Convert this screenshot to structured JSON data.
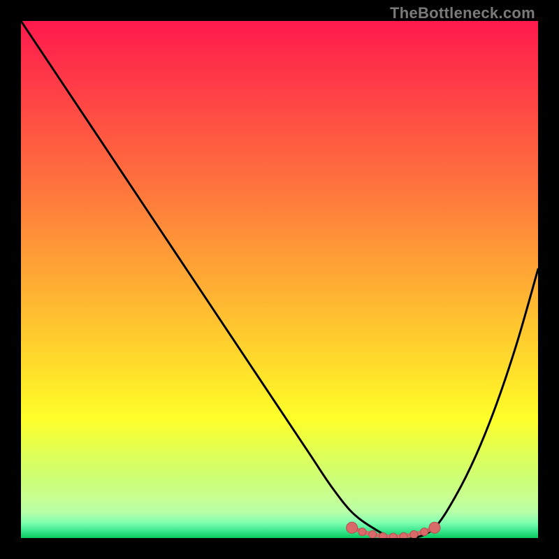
{
  "watermark": "TheBottleneck.com",
  "colors": {
    "frame_bg": "#000000",
    "curve": "#000000",
    "marker_fill": "#d96a6a",
    "marker_stroke": "#b34f4f",
    "gradient_top": "#ff1a4d",
    "gradient_bottom": "#0ac860"
  },
  "chart_data": {
    "type": "line",
    "title": "",
    "xlabel": "",
    "ylabel": "",
    "xlim": [
      0,
      100
    ],
    "ylim": [
      0,
      100
    ],
    "series": [
      {
        "name": "bottleneck-curve",
        "x": [
          0,
          4,
          8,
          12,
          16,
          20,
          24,
          28,
          32,
          36,
          40,
          44,
          48,
          52,
          56,
          60,
          64,
          68,
          72,
          76,
          80,
          84,
          88,
          92,
          96,
          100
        ],
        "values": [
          100,
          94,
          88,
          82,
          76,
          70,
          64,
          58,
          52,
          46,
          40,
          34,
          28,
          22,
          16,
          10,
          5,
          2,
          0,
          0,
          2,
          8,
          16,
          26,
          38,
          52
        ]
      }
    ],
    "markers": {
      "name": "optimal-zone",
      "x": [
        64,
        66,
        68,
        70,
        72,
        74,
        76,
        78,
        80
      ],
      "values": [
        2,
        1.2,
        0.7,
        0.3,
        0.2,
        0.3,
        0.7,
        1.2,
        2
      ]
    }
  }
}
